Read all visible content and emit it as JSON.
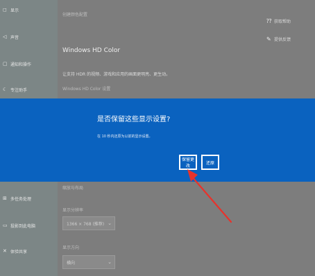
{
  "sidebar": {
    "items": [
      {
        "icon": "shield-icon",
        "glyph": "◻",
        "label": "显示"
      },
      {
        "icon": "sound-icon",
        "glyph": "◁",
        "label": "声音"
      },
      {
        "icon": "notification-icon",
        "glyph": "▢",
        "label": "通知和操作"
      },
      {
        "icon": "focus-icon",
        "glyph": "☾",
        "label": "专注助手"
      },
      {
        "icon": "multitask-icon",
        "glyph": "⊞",
        "label": "多任务处理"
      },
      {
        "icon": "project-icon",
        "glyph": "▭",
        "label": "投影到此电脑"
      },
      {
        "icon": "shared-experience-icon",
        "glyph": "✕",
        "label": "体验共享"
      }
    ]
  },
  "main": {
    "section_label": "创建颜色配置",
    "hd_title": "Windows HD Color",
    "hd_desc": "让支持 HDR 的视频、游戏和应用的画面更明亮、更生动。",
    "hd_link": "Windows HD Color 设置",
    "links": [
      {
        "icon": "help-icon",
        "glyph": "⁇",
        "label": "获取帮助"
      },
      {
        "icon": "feedback-icon",
        "glyph": "✎",
        "label": "提供反馈"
      }
    ],
    "scale_label": "缩放与布局",
    "resolution_label": "显示分辨率",
    "resolution_value": "1366 × 768 (推荐)",
    "orientation_label": "显示方向",
    "orientation_value": "横向"
  },
  "dialog": {
    "title": "是否保留这些显示设置?",
    "description": "在 10 秒内还原为以前的显示设置。",
    "keep_label": "保留更改",
    "revert_label": "还原"
  },
  "annotation": {
    "color": "#e8322b"
  }
}
